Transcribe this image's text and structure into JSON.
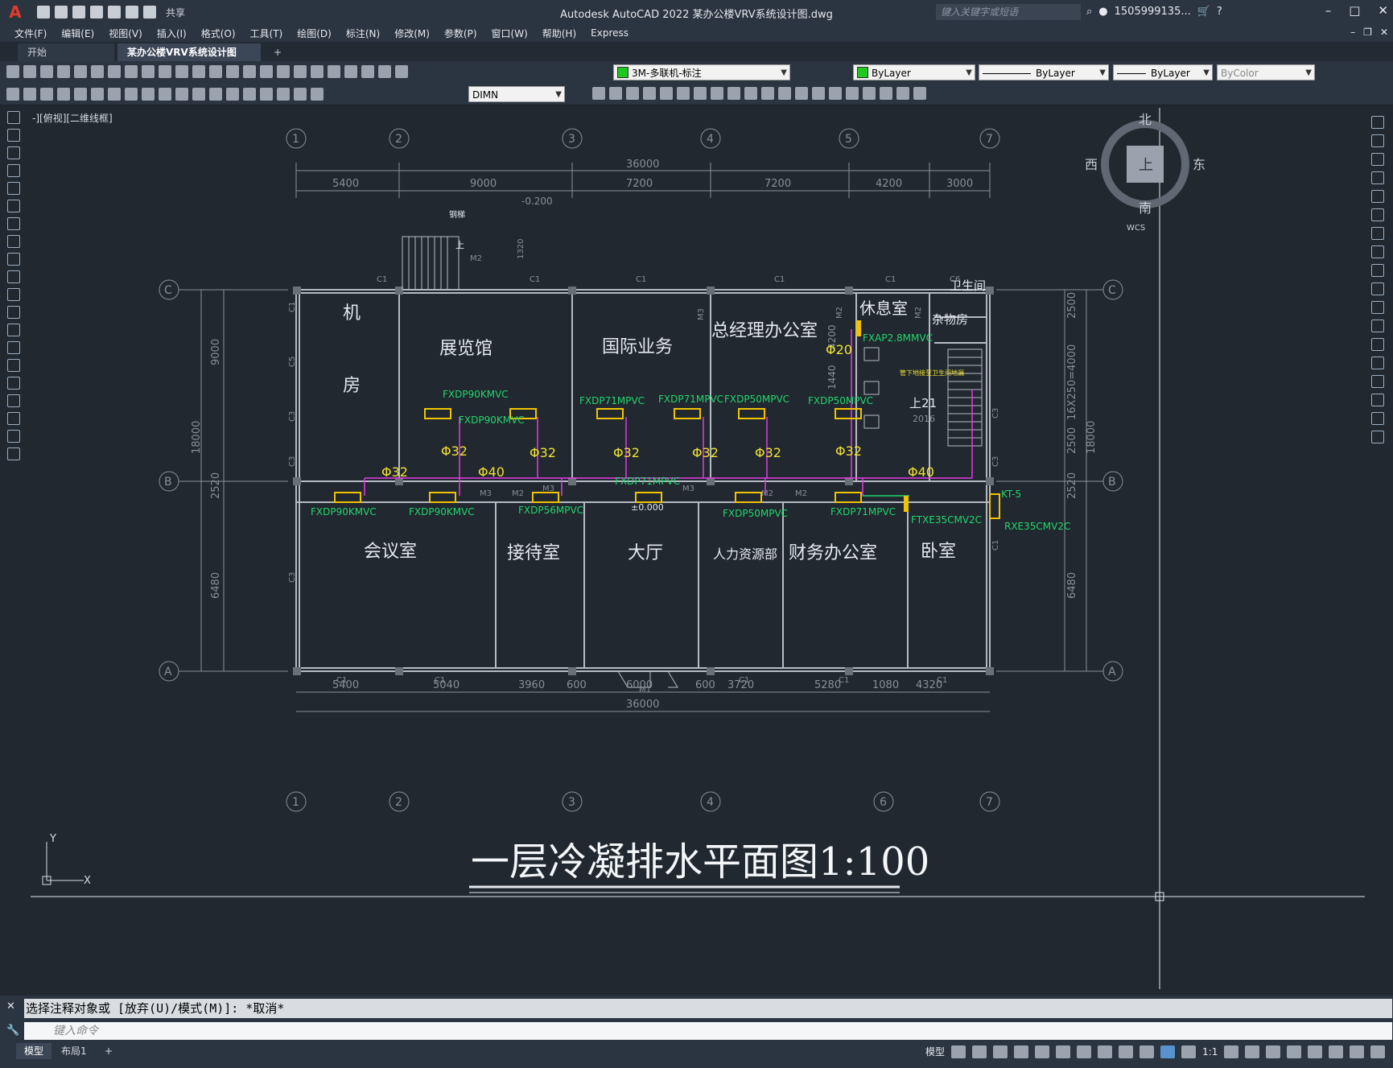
{
  "app": {
    "logo": "A",
    "window_title": "Autodesk AutoCAD 2022    某办公楼VRV系统设计图.dwg",
    "search_placeholder": "键入关键字或短语",
    "user": "1505999135...",
    "share": "共享"
  },
  "menu": [
    "文件(F)",
    "编辑(E)",
    "视图(V)",
    "插入(I)",
    "格式(O)",
    "工具(T)",
    "绘图(D)",
    "标注(N)",
    "修改(M)",
    "参数(P)",
    "窗口(W)",
    "帮助(H)",
    "Express"
  ],
  "tabs": {
    "start": "开始",
    "active": "某办公楼VRV系统设计图*",
    "plus": "+"
  },
  "toolbar": {
    "layer": "3M-多联机-标注",
    "color": "ByLayer",
    "linetype": "ByLayer",
    "lineweight": "ByLayer",
    "plotstyle": "ByColor",
    "dimstyle": "DIMN"
  },
  "viewport_label": "-][俯视][二维线框]",
  "viewcube": {
    "north": "北",
    "south": "南",
    "east": "东",
    "west": "西",
    "top": "上",
    "wcs": "WCS"
  },
  "drawing": {
    "title": "一层冷凝排水平面图1:100",
    "grid_top": [
      "1",
      "2",
      "3",
      "4",
      "5",
      "7"
    ],
    "grid_bottom": [
      "1",
      "2",
      "3",
      "4",
      "6",
      "7"
    ],
    "grid_side": [
      "C",
      "B",
      "A"
    ],
    "dims_top_total": "36000",
    "dims_top": [
      "5400",
      "9000",
      "7200",
      "7200",
      "4200",
      "3000"
    ],
    "dims_bottom_total": "36000",
    "dims_bottom": [
      "5400",
      "5040",
      "3960",
      "600",
      "6000",
      "600",
      "3720",
      "5280",
      "1080",
      "4320"
    ],
    "dims_left": [
      "9000",
      "18000",
      "2520",
      "6480"
    ],
    "dims_right": [
      "2500",
      "16X250=4000",
      "2500",
      "2520",
      "18000",
      "6480"
    ],
    "elev": "-0.200",
    "elev2": "±0.000",
    "rooms": [
      "机",
      "房",
      "展览馆",
      "国际业务",
      "总经理办公室",
      "休息室",
      "卫生间",
      "杂物房",
      "会议室",
      "接待室",
      "大厅",
      "人力资源部",
      "财务办公室",
      "卧室"
    ],
    "units": [
      "FXDP90KMVC",
      "FXDP90KMVC",
      "FXDP71MPVC",
      "FXDP71MPVC",
      "FXDP50MPVC",
      "FXDP50MPVC",
      "FXAP2.8MMVC",
      "FXDP90KMVC",
      "FXDP90KMVC",
      "FXDP56MPVC",
      "FXDP71MPVC",
      "FXDP50MPVC",
      "FXDP71MPVC",
      "FTXE35CMV2C",
      "RXE35CMV2C",
      "KT-5"
    ],
    "pipes": [
      "Φ32",
      "Φ32",
      "Φ32",
      "Φ32",
      "Φ32",
      "Φ32",
      "Φ32",
      "Φ40",
      "Φ40",
      "Φ20"
    ],
    "stair": "上21",
    "year": "2016",
    "stair_top": "上",
    "note": "管下地接至卫生间地漏",
    "label_c1": "C1",
    "label_c3": "C3",
    "label_c5": "C5",
    "label_c6": "C6",
    "label_m1": "M1",
    "label_m2": "M2",
    "label_m3": "M3",
    "dim_1320": "1320",
    "dim_4200": "4200",
    "dim_1440": "1440",
    "steps": "钢梯"
  },
  "command": {
    "history": "选择注释对象或 [放弃(U)/模式(M)]: *取消*",
    "placeholder": "键入命令"
  },
  "status": {
    "model_tab": "模型",
    "layout_tab": "布局1",
    "plus": "+",
    "model": "模型",
    "scale": "1:1"
  }
}
